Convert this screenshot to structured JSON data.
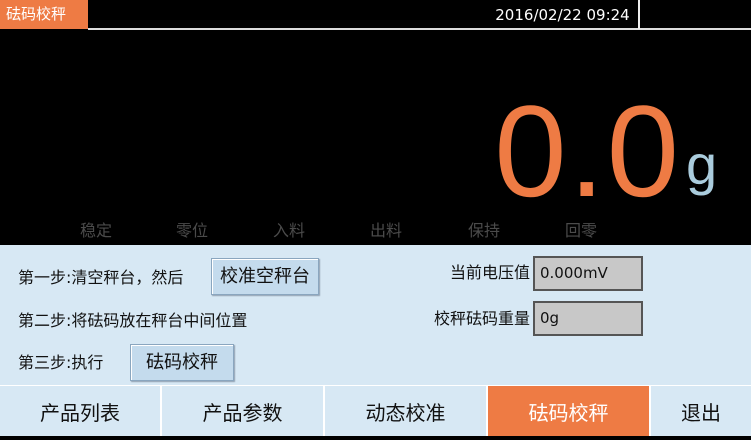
{
  "header": {
    "title": "砝码校秤",
    "datetime": "2016/02/22  09:24"
  },
  "display": {
    "weight": "0.0",
    "unit": "g",
    "indicators": [
      "稳定",
      "零位",
      "入料",
      "出料",
      "保持",
      "回零"
    ]
  },
  "calibration": {
    "step1": "第一步:清空秤台，然后",
    "step1_button": "校准空秤台",
    "step2": "第二步:将砝码放在秤台中间位置",
    "step3": "第三步:执行",
    "step3_button": "砝码校秤",
    "voltage_label": "当前电压值",
    "voltage_value": "0.000mV",
    "weight_label": "校秤砝码重量",
    "weight_value": "0g"
  },
  "nav": {
    "items": [
      "产品列表",
      "产品参数",
      "动态校准",
      "砝码校秤",
      "退出"
    ],
    "active": "砝码校秤"
  },
  "colors": {
    "accent": "#ee7b44",
    "panel": "#d7e8f4",
    "unit": "#aaccdd"
  }
}
